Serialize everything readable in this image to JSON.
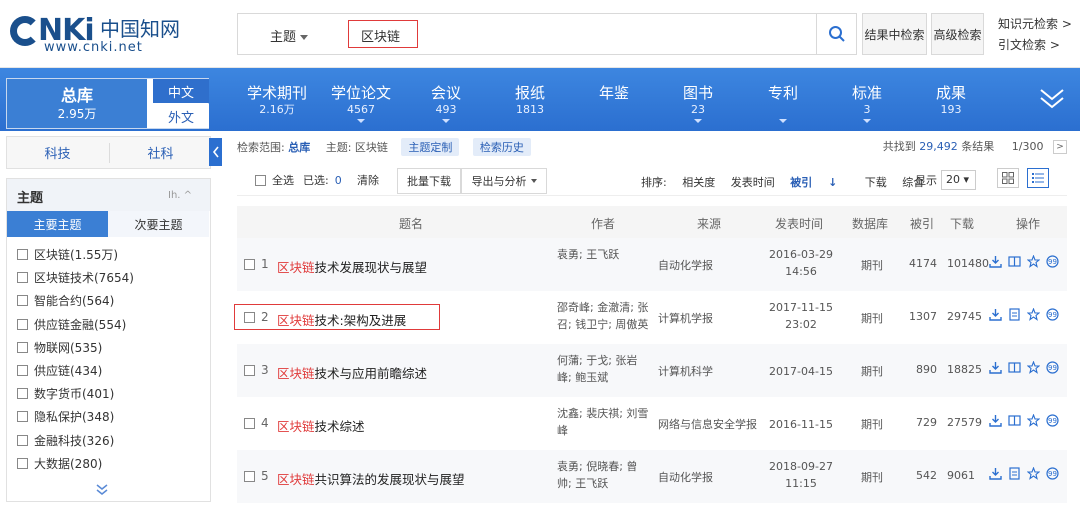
{
  "header": {
    "logo_nk": "NKi",
    "logo_cn": "中国知网",
    "logo_url": "www.cnki.net",
    "search_field": "主题",
    "search_value": "区块链",
    "within_label": "结果中检索",
    "advanced_label": "高级检索",
    "side_links": [
      "知识元检索 >",
      "引文检索 >"
    ]
  },
  "nav": {
    "total_label": "总库",
    "total_count": "2.95万",
    "lang_cn": "中文",
    "lang_en": "外文",
    "items": [
      {
        "label": "学术期刊",
        "count": "2.16万"
      },
      {
        "label": "学位论文",
        "count": "4567"
      },
      {
        "label": "会议",
        "count": "493"
      },
      {
        "label": "报纸",
        "count": "1813"
      },
      {
        "label": "年鉴",
        "count": ""
      },
      {
        "label": "图书",
        "count": "23"
      },
      {
        "label": "专利",
        "count": ""
      },
      {
        "label": "标准",
        "count": "3"
      },
      {
        "label": "成果",
        "count": "193"
      }
    ]
  },
  "sidebar": {
    "cat_tabs": [
      "科技",
      "社科"
    ],
    "facet_title": "主题",
    "facet_icons": "Ih. ^",
    "subtabs": [
      "主要主题",
      "次要主题"
    ],
    "items": [
      "区块链(1.55万)",
      "区块链技术(7654)",
      "智能合约(564)",
      "供应链金融(554)",
      "物联网(535)",
      "供应链(434)",
      "数字货币(401)",
      "隐私保护(348)",
      "金融科技(326)",
      "大数据(280)"
    ]
  },
  "crumbs": {
    "scope_label": "检索范围:",
    "scope_value": "总库",
    "topic_label": "主题: 区块链",
    "chip1": "主题定制",
    "chip2": "检索历史",
    "found_prefix": "共找到",
    "found_count": "29,492",
    "found_suffix": "条结果",
    "page": "1/300"
  },
  "toolbar": {
    "select_all": "全选",
    "selected_label": "已选:",
    "selected_count": "0",
    "clear": "清除",
    "batch_download": "批量下载",
    "export": "导出与分析",
    "sort_label": "排序:",
    "sort_options": [
      "相关度",
      "发表时间",
      "被引",
      "下载",
      "综合"
    ],
    "display_label": "显示",
    "display_value": "20"
  },
  "table": {
    "headers": [
      "题名",
      "作者",
      "来源",
      "发表时间",
      "数据库",
      "被引",
      "下载",
      "操作"
    ],
    "rows": [
      {
        "num": "1",
        "kw": "区块链",
        "title_rest": "技术发展现状与展望",
        "authors": "袁勇; 王飞跃",
        "source": "自动化学报",
        "date": "2016-03-29 14:56",
        "db": "期刊",
        "cited": "4174",
        "downloads": "101480"
      },
      {
        "num": "2",
        "kw": "区块链",
        "title_rest": "技术:架构及进展",
        "authors": "邵奇峰; 金澈清; 张召; 钱卫宁; 周傲英",
        "source": "计算机学报",
        "date": "2017-11-15 23:02",
        "db": "期刊",
        "cited": "1307",
        "downloads": "29745"
      },
      {
        "num": "3",
        "kw": "区块链",
        "title_rest": "技术与应用前瞻综述",
        "authors": "何蒲; 于戈; 张岩峰; 鲍玉斌",
        "source": "计算机科学",
        "date": "2017-04-15",
        "db": "期刊",
        "cited": "890",
        "downloads": "18825"
      },
      {
        "num": "4",
        "kw": "区块链",
        "title_rest": "技术综述",
        "authors": "沈鑫; 裴庆祺; 刘雪峰",
        "source": "网络与信息安全学报",
        "date": "2016-11-15",
        "db": "期刊",
        "cited": "729",
        "downloads": "27579"
      },
      {
        "num": "5",
        "kw": "区块链",
        "title_rest": "共识算法的发展现状与展望",
        "authors": "袁勇; 倪晓春; 曾帅; 王飞跃",
        "source": "自动化学报",
        "date": "2018-09-27 11:15",
        "db": "期刊",
        "cited": "542",
        "downloads": "9061"
      }
    ]
  },
  "colors": {
    "brand_blue": "#2b6fd0",
    "keyword_red": "#e03a3a",
    "link_blue": "#2a5fb5"
  }
}
